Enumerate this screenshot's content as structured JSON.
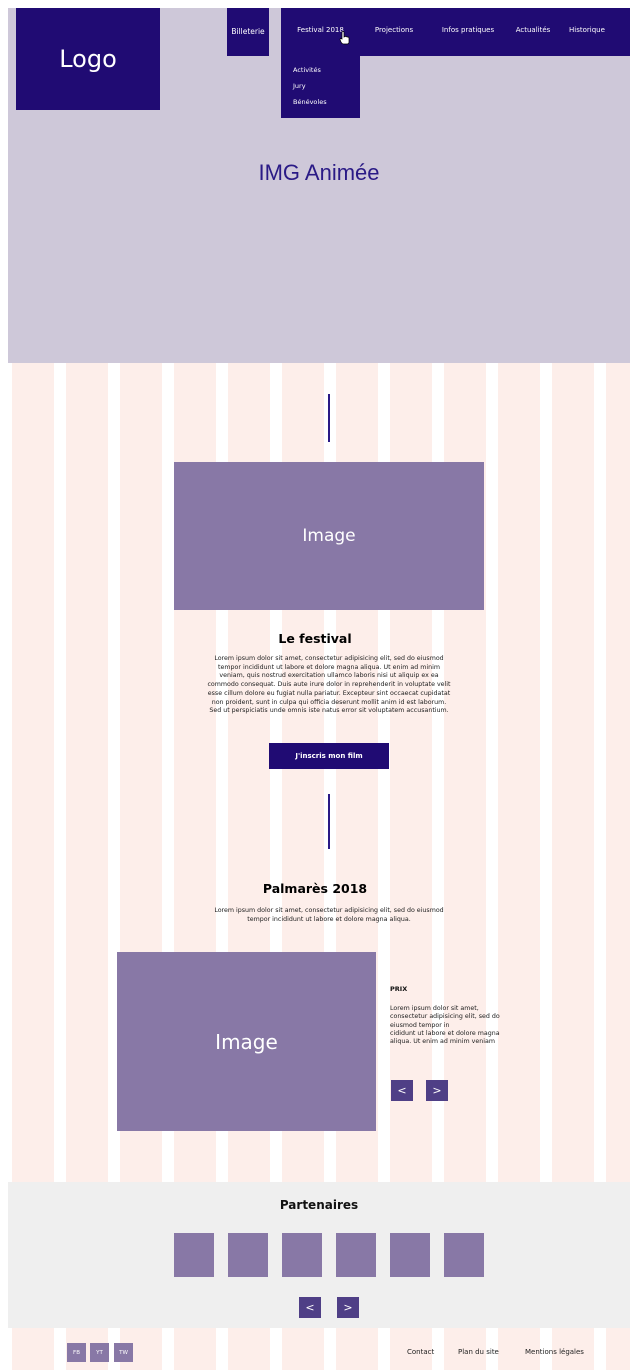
{
  "header": {
    "logo_label": "Logo",
    "nav": {
      "billeterie": "Billeterie",
      "festival": "Festival 2018",
      "projections": "Projections",
      "infos": "Infos pratiques",
      "actualites": "Actualités",
      "historique": "Historique"
    },
    "dropdown": [
      "Activités",
      "Jury",
      "Bénévoles"
    ]
  },
  "hero": {
    "title": "IMG Animée"
  },
  "festival_section": {
    "image_label": "Image",
    "title": "Le festival",
    "paragraph_lines": [
      "Lorem ipsum dolor sit amet, consectetur adipisicing elit, sed do eiusmod",
      "tempor incididunt ut labore et dolore magna aliqua. Ut enim ad minim",
      "veniam, quis nostrud exercitation ullamco laboris nisi ut aliquip ex ea",
      "commodo consequat. Duis aute irure dolor in reprehenderit in voluptate velit",
      "esse cillum dolore eu fugiat nulla pariatur. Excepteur sint occaecat cupidatat",
      "non proident, sunt in culpa qui officia deserunt mollit anim id est laborum.",
      "Sed ut perspiciatis unde omnis iste natus error sit voluptatem accusantium."
    ],
    "cta_label": "J'inscris mon film"
  },
  "palmares_section": {
    "title": "Palmarès 2018",
    "intro_lines": [
      "Lorem ipsum dolor sit amet, consectetur adipisicing elit, sed do eiusmod",
      "tempor incididunt ut labore et dolore magna aliqua."
    ],
    "image_label": "Image",
    "prix_title": "PRIX",
    "prix_lines": [
      "Lorem ipsum dolor sit amet,",
      "consectetur adipisicing elit, sed do",
      "eiusmod tempor in",
      "cididunt ut labore et dolore magna",
      "aliqua. Ut enim ad minim veniam"
    ],
    "prev": "<",
    "next": ">"
  },
  "partners_section": {
    "title": "Partenaires",
    "prev": "<",
    "next": ">"
  },
  "footer": {
    "social": [
      "FB",
      "YT",
      "TW"
    ],
    "links": [
      "Contact",
      "Plan du site",
      "Mentions légales"
    ]
  }
}
